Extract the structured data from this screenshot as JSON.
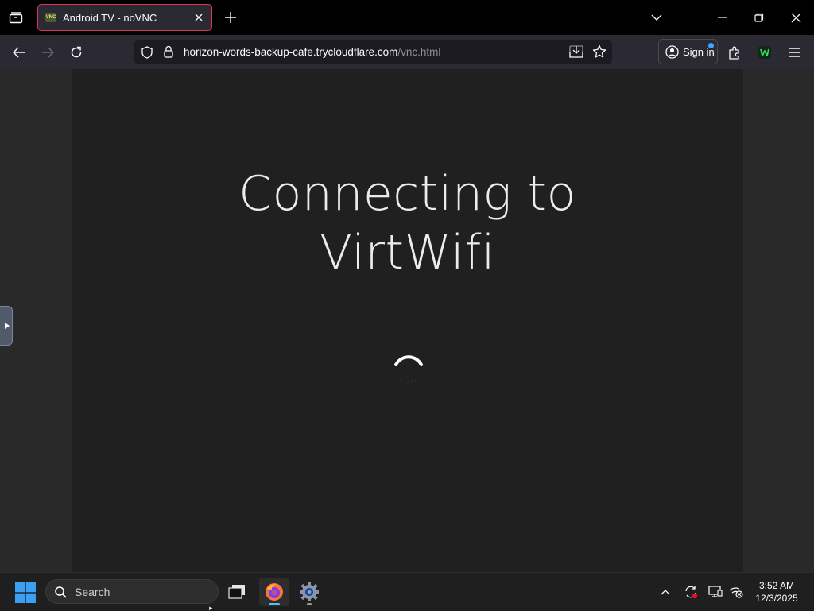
{
  "browser": {
    "tab": {
      "title": "Android TV - noVNC",
      "favicon_text": "VNC"
    },
    "url": {
      "domain": "horizon-words-backup-cafe.trycloudflare.com",
      "path": "/vnc.html"
    },
    "signin_label": "Sign in"
  },
  "vnc": {
    "heading_line1": "Connecting to",
    "heading_line2": "VirtWifi"
  },
  "taskbar": {
    "search_placeholder": "Search",
    "clock_time": "3:52 AM",
    "clock_date": "12/3/2025"
  },
  "colors": {
    "tab_border": "#e0345f",
    "browser_bg": "#2b2a33",
    "vnc_bg": "#202020",
    "accent_blue": "#3fa7ff"
  },
  "icons": [
    "tab-list-icon",
    "close-icon",
    "plus-icon",
    "chevron-down-icon",
    "minimize-icon",
    "restore-icon",
    "back-icon",
    "forward-icon",
    "reload-icon",
    "shield-icon",
    "lock-icon",
    "save-page-icon",
    "star-icon",
    "account-icon",
    "extensions-icon",
    "extension-w-icon",
    "menu-icon",
    "windows-start-icon",
    "search-icon",
    "file-explorer-icon",
    "firefox-icon",
    "settings-gear-icon",
    "chevron-up-icon",
    "sync-icon",
    "display-icon",
    "network-icon",
    "spinner-icon"
  ]
}
